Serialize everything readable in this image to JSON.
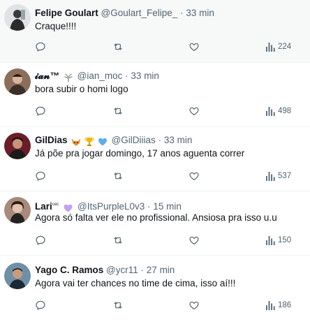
{
  "tweets": [
    {
      "name": "Felipe Goulart",
      "handle": "@Goulart_Felipe_",
      "sep": "·",
      "time": "33 min",
      "text": "Craque!!!!",
      "views": "224"
    },
    {
      "name": "𝓲𝓪𝓷™",
      "handle": "@ian_moc",
      "sep": "·",
      "time": "33 min",
      "text": "bora subir o homi logo",
      "views": "498"
    },
    {
      "name": "GilDias",
      "handle": "@GilDiiias",
      "sep": "·",
      "time": "33 min",
      "text": "Já põe pra jogar domingo, 17 anos aguenta correr",
      "views": "537"
    },
    {
      "name": "Lari",
      "name_suffix": "ᶜᵉᶜ",
      "handle": "@ItsPurpleL0v3",
      "sep": "·",
      "time": "15 min",
      "text": "Agora só falta ver ele no profissional. Ansiosa pra isso u.u",
      "views": "150"
    },
    {
      "name": "Yago C. Ramos",
      "handle": "@ycr11",
      "sep": "·",
      "time": "27 min",
      "text": "Agora vai ter chances no time de cima, isso aí!!!",
      "views": "186"
    }
  ],
  "icons": {
    "reply": "reply-icon",
    "retweet": "retweet-icon",
    "like": "heart-icon",
    "views": "views-icon"
  },
  "colors": {
    "text_primary": "#0f1419",
    "text_secondary": "#536471",
    "divider": "#eff3f4",
    "heart_badge": "#c1a0f0",
    "blue_heart": "#5dadec",
    "trophy": "#f4b400",
    "fox": "#f08c2e"
  }
}
